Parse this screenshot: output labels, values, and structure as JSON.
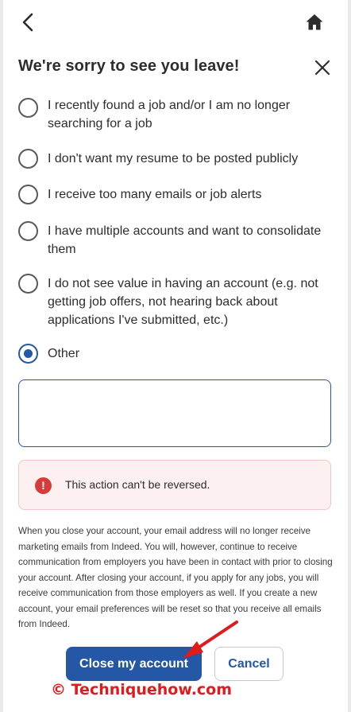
{
  "header": {
    "title": "We're sorry to see you leave!"
  },
  "options": [
    {
      "label": "I recently found a job and/or I am no longer searching for a job",
      "checked": false
    },
    {
      "label": "I don't want my resume to be posted publicly",
      "checked": false
    },
    {
      "label": "I receive too many emails or job alerts",
      "checked": false
    },
    {
      "label": "I have multiple accounts and want to consolidate them",
      "checked": false
    },
    {
      "label": "I do not see value in having an account (e.g. not getting job offers, not hearing back about applications I've submitted, etc.)",
      "checked": false
    },
    {
      "label": "Other",
      "checked": true
    }
  ],
  "other_input": {
    "value": ""
  },
  "alert": {
    "icon_glyph": "!",
    "text": "This action can't be reversed."
  },
  "info_text": "When you close your account, your email address will no longer receive marketing emails from Indeed. You will, however, continue to receive communication from employers you have been in contact with prior to closing your account. After closing your account, if you apply for any jobs, you will receive communication from those employers as well. If you create a new account, your email preferences will be reset so that you receive all emails from Indeed.",
  "buttons": {
    "close_account": "Close my account",
    "cancel": "Cancel"
  },
  "watermark": "© Techniquehow.com",
  "colors": {
    "primary": "#2557a7",
    "alert_bg": "#fcf0f0",
    "alert_icon": "#d63c3c",
    "watermark": "#e01b1b"
  },
  "icons": {
    "back": "chevron-left-icon",
    "home": "home-icon",
    "close": "close-icon",
    "alert": "exclamation-circle-icon"
  }
}
